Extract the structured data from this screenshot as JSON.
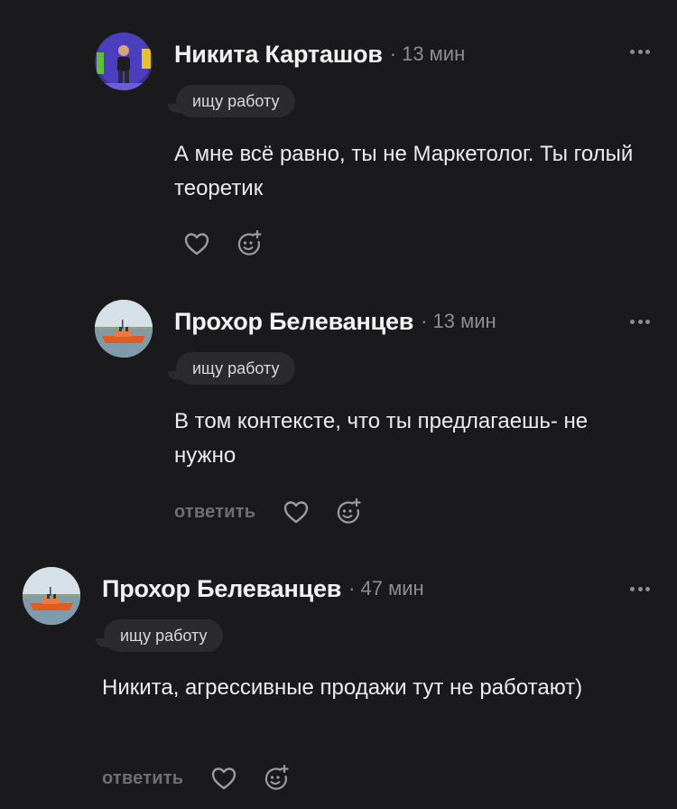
{
  "comments": [
    {
      "author": "Никита Карташов",
      "separator": "·",
      "time": "13 мин",
      "badge": "ищу работу",
      "text": "А мне всё равно, ты не Маркетолог. Ты голый теоретик",
      "reply": "",
      "avatar": "person-photo"
    },
    {
      "author": "Прохор Белеванцев",
      "separator": "·",
      "time": "13 мин",
      "badge": "ищу работу",
      "text": "В том контексте, что ты предлагаешь- не нужно",
      "reply": "ответить",
      "avatar": "boat-photo"
    },
    {
      "author": "Прохор Белеванцев",
      "separator": "·",
      "time": "47 мин",
      "badge": "ищу работу",
      "text": "Никита, агрессивные продажи тут не работают)",
      "reply": "ответить",
      "avatar": "boat-photo"
    }
  ],
  "icons": {
    "like": "heart-icon",
    "react": "add-emoji-icon",
    "more": "more-dots-icon"
  },
  "colors": {
    "background": "#1a1a1c",
    "badge_bg": "#2b2b2e",
    "muted": "#8d8d92",
    "text": "#ececee"
  }
}
